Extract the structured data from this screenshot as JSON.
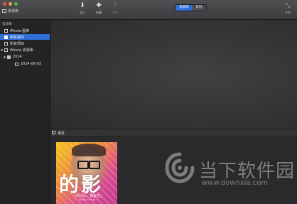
{
  "titlebar": {
    "library_label": "资源库"
  },
  "toolbar": {
    "import_label": "导入",
    "create_label": "创建",
    "share_label": "共享",
    "view_toggle": {
      "options": [
        "资源库",
        "影院"
      ],
      "selected": "资源库"
    },
    "right_label": "共享"
  },
  "sidebar": {
    "header": "资源库",
    "items": [
      {
        "label": "iPhoto 图库"
      },
      {
        "label": "所有事件",
        "selected": true
      },
      {
        "label": "所有项目"
      },
      {
        "label": "iMovie 资源库"
      },
      {
        "label": "2014"
      },
      {
        "label": "2014-06-02"
      }
    ]
  },
  "events_bar": {
    "label": "事件"
  },
  "thumbnail": {
    "big_text": "的影",
    "small_text": "「为什么，我会在」",
    "tiny_text": "· Ethan Cheng ·"
  },
  "watermark": {
    "title": "当下软件园",
    "url": "www.downxia.com"
  },
  "colors": {
    "accent": "#2f6fd6",
    "sidebar_bg": "#242426",
    "content_bg": "#2b2b2d"
  }
}
